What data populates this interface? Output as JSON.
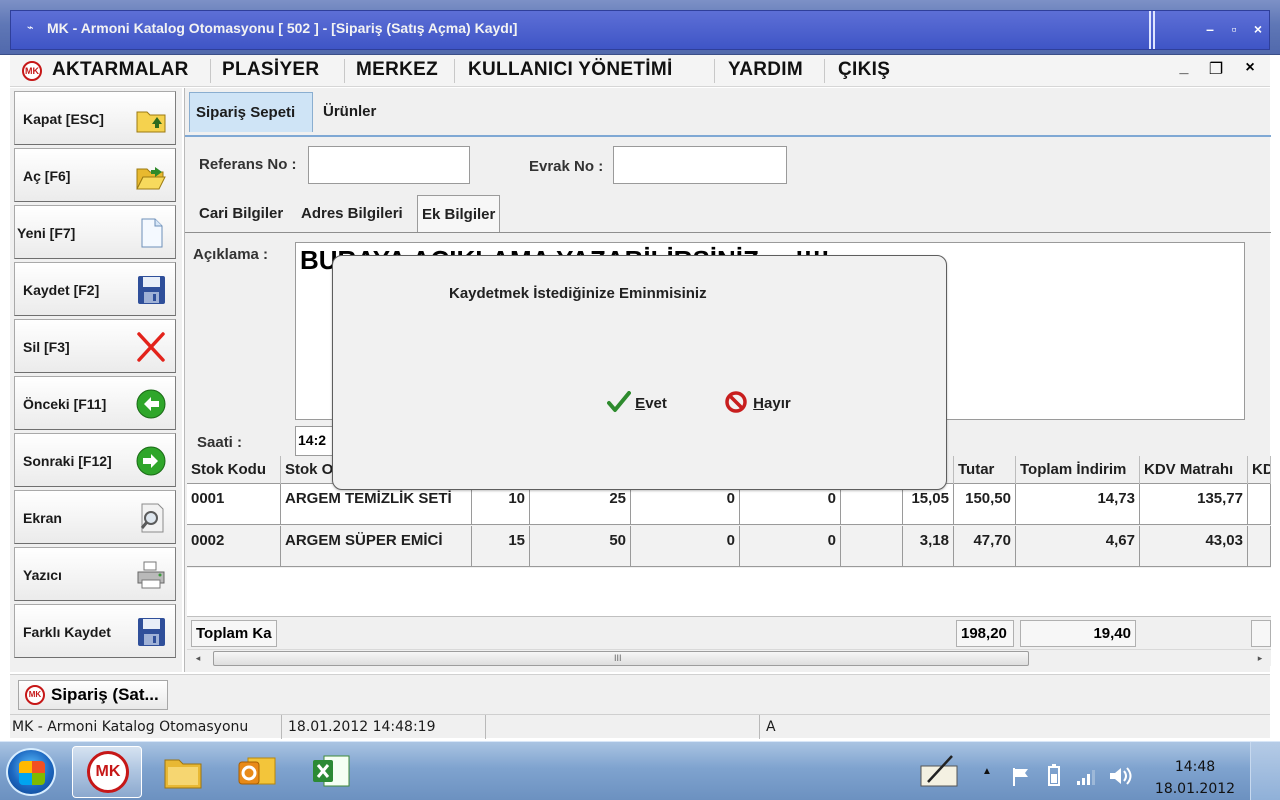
{
  "window": {
    "title": "MK - Armoni Katalog Otomasyonu [ 502 ] - [Sipariş (Satış Açma) Kaydı]",
    "sysmenu_icon": "⌁",
    "minimize_glyph": "–",
    "maximize_glyph": "▫",
    "close_glyph": "×"
  },
  "menu": {
    "items": [
      "AKTARMALAR",
      "PLASİYER",
      "MERKEZ",
      "KULLANICI YÖNETİMİ",
      "YARDIM",
      "ÇIKIŞ"
    ],
    "logo_text": "MK",
    "mdi_min": "_",
    "mdi_restore": "❐",
    "mdi_close": "×"
  },
  "toolbar": {
    "buttons": [
      {
        "label": "Kapat [ESC]",
        "icon": "folder-up-icon"
      },
      {
        "label": "Aç [F6]",
        "icon": "folder-open-icon"
      },
      {
        "label": "Yeni [F7]",
        "icon": "new-document-icon"
      },
      {
        "label": "Kaydet [F2]",
        "icon": "floppy-disk-icon"
      },
      {
        "label": "Sil [F3]",
        "icon": "delete-x-icon"
      },
      {
        "label": "Önceki [F11]",
        "icon": "arrow-left-icon"
      },
      {
        "label": "Sonraki [F12]",
        "icon": "arrow-right-icon"
      },
      {
        "label": "Ekran",
        "icon": "preview-magnifier-icon"
      },
      {
        "label": "Yazıcı",
        "icon": "printer-icon"
      },
      {
        "label": "Farklı Kaydet",
        "icon": "floppy-disk-icon"
      }
    ]
  },
  "main": {
    "tabs": [
      {
        "label": "Sipariş Sepeti",
        "active": true
      },
      {
        "label": "Ürünler",
        "active": false
      }
    ],
    "referans_label": "Referans No :",
    "referans_value": "",
    "evrak_label": "Evrak No :",
    "evrak_value": "",
    "subtabs": [
      {
        "label": "Cari Bilgiler",
        "active": false
      },
      {
        "label": "Adres Bilgileri",
        "active": false
      },
      {
        "label": "Ek Bilgiler",
        "active": true
      }
    ],
    "aciklama_label": "Açıklama :",
    "aciklama_value": "BURAYA AÇIKLAMA YAZABİLİRSİNİZ.....!!!!",
    "saati_label": "Saati :",
    "saati_value": "14:2"
  },
  "grid": {
    "columns": [
      "Stok Kodu",
      "Stok O",
      "",
      "",
      "",
      "",
      "",
      "",
      "Tutar",
      "Toplam İndirim",
      "KDV Matrahı",
      "KD"
    ],
    "rows": [
      [
        "0001",
        "ARGEM TEMİZLİK SETİ",
        "10",
        "25",
        "0",
        "0",
        "",
        "15,05",
        "150,50",
        "14,73",
        "135,77",
        ""
      ],
      [
        "0002",
        "ARGEM SÜPER EMİCİ",
        "15",
        "50",
        "0",
        "0",
        "",
        "3,18",
        "47,70",
        "4,67",
        "43,03",
        ""
      ]
    ],
    "footer_label": "Toplam Ka",
    "footer_tutar": "198,20",
    "footer_indirim": "19,40",
    "scroll_grip": "III",
    "arrow_left": "◂",
    "arrow_right": "▸"
  },
  "dialog": {
    "message": "Kaydetmek İstediğinize Eminmisiniz",
    "yes_label_first": "E",
    "yes_label_rest": "vet",
    "no_label_first": "H",
    "no_label_rest": "ayır",
    "yes_icon": "checkmark-icon",
    "no_icon": "no-entry-icon"
  },
  "window_tab": {
    "label": "Sipariş (Sat...",
    "logo_text": "MK"
  },
  "statusbar": {
    "app": "MK - Armoni Katalog Otomasyonu",
    "datetime": "18.01.2012 14:48:19",
    "empty": "",
    "mode": "A"
  },
  "taskbar": {
    "apps": [
      "mk-app-icon",
      "file-explorer-icon",
      "outlook-icon",
      "excel-icon"
    ],
    "mk_text": "MK",
    "time": "14:48",
    "date": "18.01.2012",
    "tray_arrow": "▲"
  },
  "colors": {
    "title_blue": "#3f55c6",
    "tab_active": "#cfe4f6",
    "mk_red": "#c61717",
    "check_green": "#2e8b2e",
    "no_red": "#c81e1e"
  }
}
